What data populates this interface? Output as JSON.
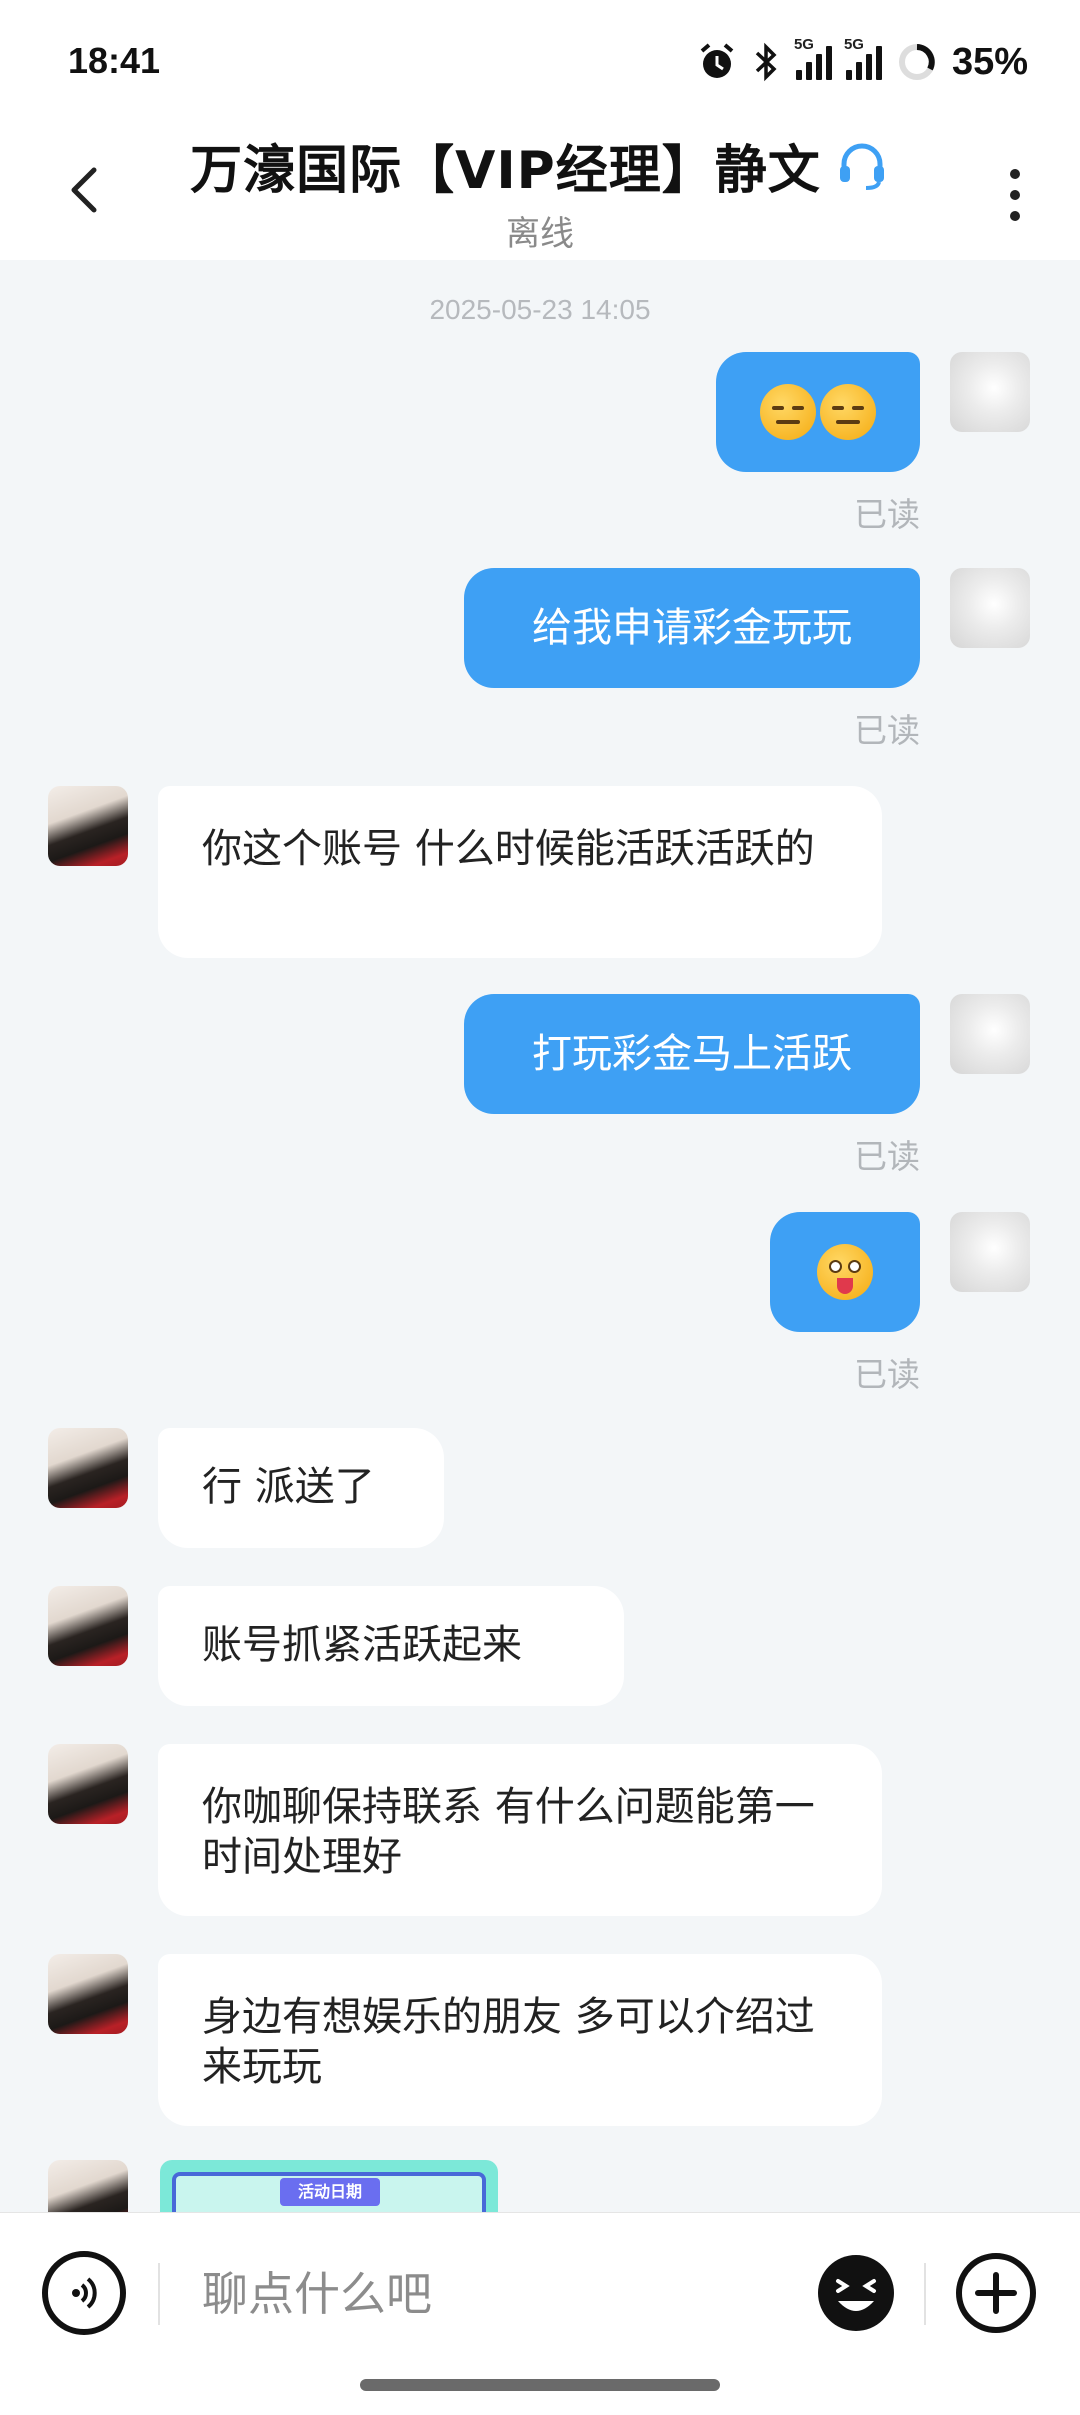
{
  "status_bar": {
    "time": "18:41",
    "signal_label_1": "5G",
    "signal_label_2": "5G",
    "battery": "35%",
    "icons": [
      "alarm-icon",
      "bluetooth-icon",
      "signal-icon",
      "signal-icon",
      "battery-ring-icon"
    ]
  },
  "header": {
    "title": "万濠国际【VIP经理】静文",
    "status": "离线",
    "icons": [
      "back-arrow-icon",
      "headset-icon",
      "more-vertical-icon"
    ]
  },
  "chat": {
    "timestamp": "2025-05-23 14:05",
    "read_label": "已读",
    "messages": [
      {
        "from": "me",
        "type": "emoji",
        "emoji": [
          "expressionless-face",
          "expressionless-face"
        ]
      },
      {
        "from": "me",
        "type": "text",
        "text": "给我申请彩金玩玩"
      },
      {
        "from": "agent",
        "type": "text",
        "text": "你这个账号  什么时候能活跃活跃的"
      },
      {
        "from": "me",
        "type": "text",
        "text": "打玩彩金马上活跃"
      },
      {
        "from": "me",
        "type": "emoji",
        "emoji": [
          "tongue-out-face"
        ]
      },
      {
        "from": "agent",
        "type": "text",
        "text": "行  派送了"
      },
      {
        "from": "agent",
        "type": "text",
        "text": "账号抓紧活跃起来"
      },
      {
        "from": "agent",
        "type": "text",
        "text": "你咖聊保持联系  有什么问题能第一时间处理好"
      },
      {
        "from": "agent",
        "type": "text",
        "text": "身边有想娱乐的朋友 多可以介绍过来玩玩"
      },
      {
        "from": "agent",
        "type": "image",
        "caption": "活动日期"
      }
    ]
  },
  "input_bar": {
    "placeholder": "聊点什么吧",
    "icons": [
      "voice-icon",
      "emoji-icon",
      "plus-icon"
    ]
  },
  "colors": {
    "accent": "#3ea0f4",
    "background": "#f3f6f8",
    "read_text": "#b2b6ba"
  }
}
